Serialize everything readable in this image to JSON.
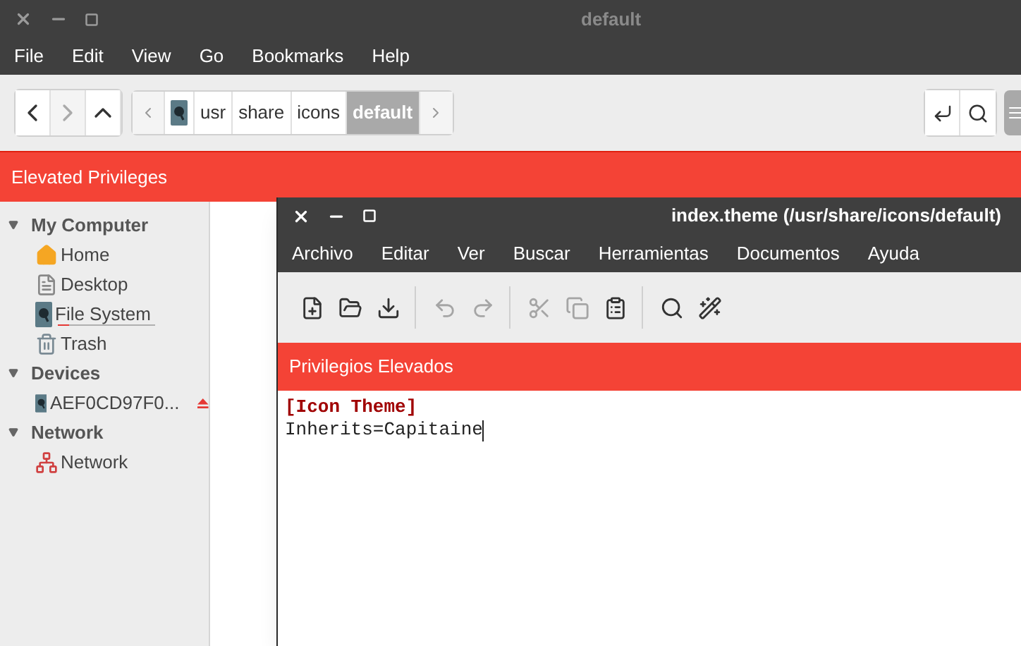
{
  "file_manager": {
    "window": {
      "title": "default"
    },
    "menu": [
      "File",
      "Edit",
      "View",
      "Go",
      "Bookmarks",
      "Help"
    ],
    "nav": [
      {
        "kind": "back",
        "disabled": false
      },
      {
        "kind": "forward",
        "disabled": true
      },
      {
        "kind": "up",
        "disabled": false
      }
    ],
    "breadcrumb": [
      {
        "kind": "drive",
        "selected": false
      },
      {
        "kind": "folder",
        "label": "usr",
        "selected": false
      },
      {
        "kind": "folder",
        "label": "share",
        "selected": false
      },
      {
        "kind": "folder",
        "label": "icons",
        "selected": false
      },
      {
        "kind": "folder",
        "label": "default",
        "selected": true
      }
    ],
    "banner": "Elevated Privileges",
    "sidebar": [
      {
        "label": "My Computer",
        "expanded": true,
        "children": [
          {
            "label": "Home",
            "kind": "home"
          },
          {
            "label": "Desktop",
            "kind": "desktop"
          },
          {
            "label": "File System",
            "kind": "drive",
            "level": 0.12
          },
          {
            "label": "Trash",
            "kind": "trash"
          }
        ]
      },
      {
        "label": "Devices",
        "expanded": true,
        "children": [
          {
            "label": "AEF0CD97F0...",
            "kind": "drive",
            "eject": true
          }
        ]
      },
      {
        "label": "Network",
        "expanded": true,
        "children": [
          {
            "label": "Network",
            "kind": "network"
          }
        ]
      }
    ]
  },
  "editor": {
    "window": {
      "title": "index.theme (/usr/share/icons/default)"
    },
    "menu": [
      "Archivo",
      "Editar",
      "Ver",
      "Buscar",
      "Herramientas",
      "Documentos",
      "Ayuda"
    ],
    "toolbar": [
      [
        {
          "kind": "new",
          "disabled": false
        },
        {
          "kind": "open",
          "disabled": false
        },
        {
          "kind": "save",
          "disabled": false
        }
      ],
      [
        {
          "kind": "undo",
          "disabled": true
        },
        {
          "kind": "redo",
          "disabled": true
        }
      ],
      [
        {
          "kind": "cut",
          "disabled": true
        },
        {
          "kind": "copy",
          "disabled": true
        },
        {
          "kind": "paste",
          "disabled": false
        }
      ],
      [
        {
          "kind": "find",
          "disabled": false
        },
        {
          "kind": "tools",
          "disabled": false
        }
      ]
    ],
    "banner": "Privilegios Elevados",
    "lines": [
      {
        "kind": "section",
        "text": "[Icon Theme]"
      },
      {
        "kind": "plain",
        "text": "Inherits=Capitaine",
        "caret": true
      }
    ]
  }
}
